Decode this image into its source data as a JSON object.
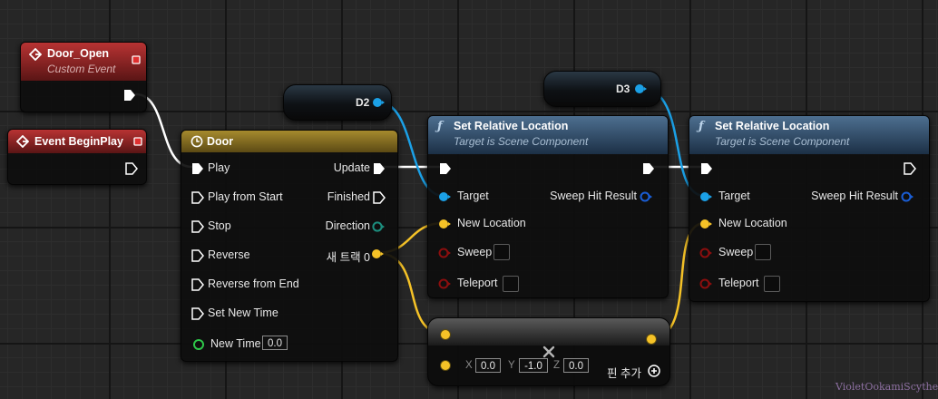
{
  "custom_event": {
    "title": "Door_Open",
    "subtitle": "Custom Event"
  },
  "begin_play": {
    "title": "Event BeginPlay"
  },
  "timeline": {
    "title": "Door",
    "inputs": [
      "Play",
      "Play from Start",
      "Stop",
      "Reverse",
      "Reverse from End",
      "Set New Time"
    ],
    "new_time_label": "New Time",
    "new_time_value": "0.0",
    "outputs": {
      "update": "Update",
      "finished": "Finished",
      "direction": "Direction",
      "track": "새 트랙 0"
    }
  },
  "var_d2": {
    "label": "D2"
  },
  "var_d3": {
    "label": "D3"
  },
  "set_loc_1": {
    "title": "Set Relative Location",
    "subtitle": "Target is Scene Component",
    "target": "Target",
    "sweep_hit": "Sweep Hit Result",
    "new_location": "New Location",
    "sweep": "Sweep",
    "teleport": "Teleport"
  },
  "set_loc_2": {
    "title": "Set Relative Location",
    "subtitle": "Target is Scene Component",
    "target": "Target",
    "sweep_hit": "Sweep Hit Result",
    "new_location": "New Location",
    "sweep": "Sweep",
    "teleport": "Teleport"
  },
  "add_vector": {
    "x_label": "X",
    "x_value": "0.0",
    "y_label": "Y",
    "y_value": "-1.0",
    "z_label": "Z",
    "z_value": "0.0",
    "add_pin_label": "핀 추가"
  },
  "watermark": "VioletOokamiScythe",
  "colors": {
    "exec": "#ffffff",
    "object": "#1ba0e6",
    "vector": "#f5c227",
    "bool": "#8c0e0e",
    "float": "#2ec84a"
  }
}
